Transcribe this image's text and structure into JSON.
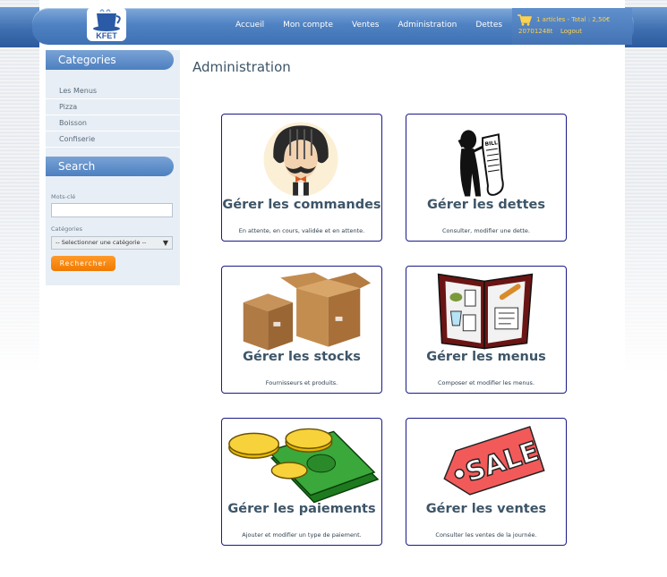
{
  "nav": {
    "logo_text": "KFET",
    "links": [
      "Accueil",
      "Mon compte",
      "Ventes",
      "Administration",
      "Dettes"
    ],
    "cart_summary": "1 articles - Total : 2,50€",
    "user_id": "20701248t",
    "logout": "Logout"
  },
  "sidebar": {
    "categories_title": "Categories",
    "categories": [
      "Les Menus",
      "Pizza",
      "Boisson",
      "Confiserie"
    ],
    "search_title": "Search",
    "keyword_label": "Mots-clé",
    "keyword_value": "",
    "category_label": "Catégories",
    "category_selected": "-- Selectionner une catégorie --",
    "search_button": "Rechercher"
  },
  "main": {
    "title": "Administration",
    "cards": [
      {
        "title": "Gérer les commandes",
        "desc": "En attente, en cours, validée et en attente.",
        "icon": "chef-icon"
      },
      {
        "title": "Gérer les dettes",
        "desc": "Consulter, modifier une dette.",
        "icon": "bill-icon"
      },
      {
        "title": "Gérer les stocks",
        "desc": "Fournisseurs et produits.",
        "icon": "boxes-icon"
      },
      {
        "title": "Gérer les menus",
        "desc": "Composer et modifier les menus.",
        "icon": "menu-icon"
      },
      {
        "title": "Gérer les paiements",
        "desc": "Ajouter et modifier un type de paiement.",
        "icon": "money-icon"
      },
      {
        "title": "Gérer les ventes",
        "desc": "Consulter les ventes de la journée.",
        "icon": "sale-tag-icon"
      }
    ],
    "sale_tag_text": "SALE",
    "bill_text": "BILL"
  },
  "colors": {
    "nav_blue": "#4f82c3",
    "title": "#3d5568",
    "card_border": "#1a1a8c",
    "cart_text": "#ffd24a",
    "search_button": "#f07a00"
  }
}
